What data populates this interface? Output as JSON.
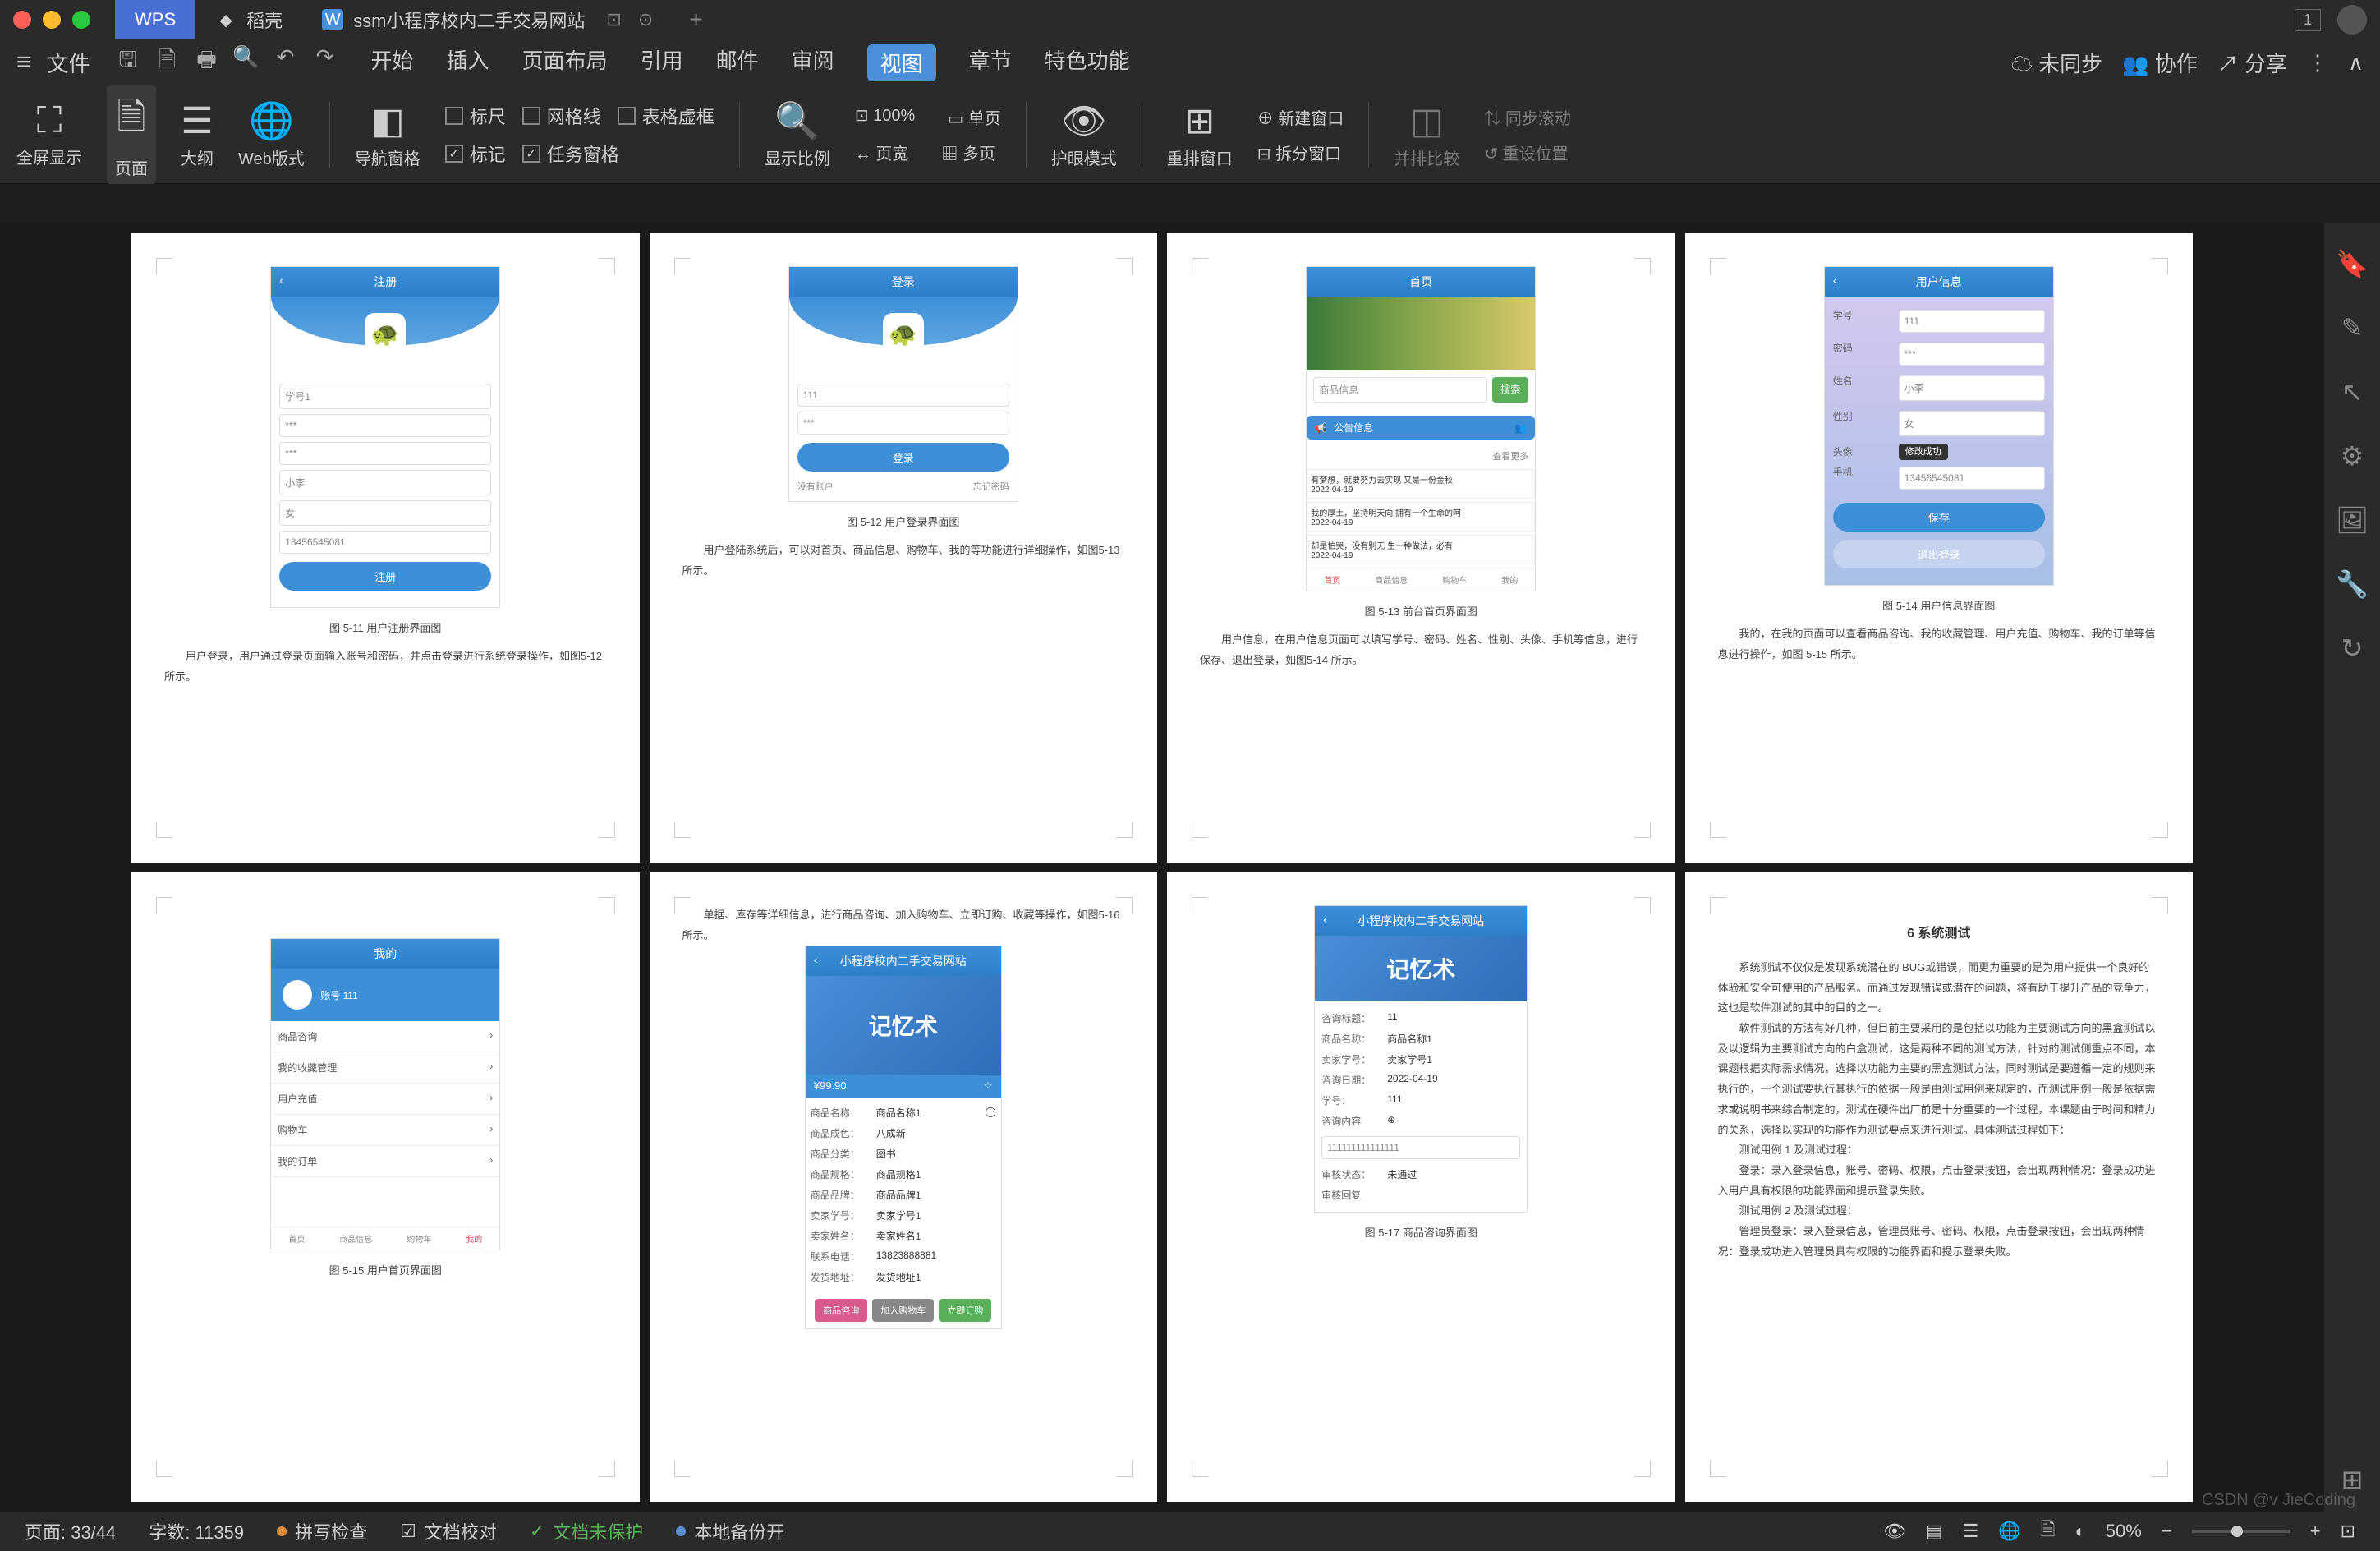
{
  "titlebar": {
    "tabs": [
      {
        "label": "WPS",
        "active": true
      },
      {
        "label": "稻壳",
        "active": false
      },
      {
        "label": "ssm小程序校内二手交易网站",
        "active": false
      }
    ]
  },
  "menubar": {
    "file": "文件",
    "tabs": [
      "开始",
      "插入",
      "页面布局",
      "引用",
      "邮件",
      "审阅",
      "视图",
      "章节",
      "特色功能"
    ],
    "active_tab": "视图",
    "right": {
      "sync": "未同步",
      "collab": "协作",
      "share": "分享"
    }
  },
  "ribbon": {
    "fullscreen": "全屏显示",
    "page": "页面",
    "outline": "大纲",
    "web": "Web版式",
    "nav_pane": "导航窗格",
    "ruler": "标尺",
    "gridlines": "网格线",
    "table_gridlines": "表格虚框",
    "markup": "标记",
    "task_pane": "任务窗格",
    "zoom": "显示比例",
    "zoom100": "100%",
    "page_width": "页宽",
    "single_page": "单页",
    "multi_page": "多页",
    "eye_mode": "护眼模式",
    "rearrange": "重排窗口",
    "new_window": "新建窗口",
    "split_window": "拆分窗口",
    "side_by_side": "并排比较",
    "sync_scroll": "同步滚动",
    "reset_pos": "重设位置"
  },
  "pages": {
    "p1": {
      "mobile_title": "注册",
      "fields": [
        "学号1",
        "***",
        "***",
        "小李",
        "女",
        "13456545081"
      ],
      "btn": "注册",
      "caption": "图 5-11 用户注册界面图",
      "text": "用户登录，用户通过登录页面输入账号和密码，并点击登录进行系统登录操作，如图5-12所示。"
    },
    "p2": {
      "mobile_title": "登录",
      "fields": [
        "111",
        "***"
      ],
      "btn": "登录",
      "link": "没有账户",
      "forgot": "忘记密码",
      "caption": "图 5-12 用户登录界面图",
      "text": "用户登陆系统后，可以对首页、商品信息、购物车、我的等功能进行详细操作，如图5-13 所示。"
    },
    "p3": {
      "mobile_title": "首页",
      "search_placeholder": "商品信息",
      "search_btn": "搜索",
      "notice": "公告信息",
      "more": "查看更多",
      "caption": "图 5-13 前台首页界面图",
      "text": "用户信息，在用户信息页面可以填写学号、密码、姓名、性别、头像、手机等信息，进行保存、退出登录，如图5-14 所示。"
    },
    "p4": {
      "mobile_title": "用户信息",
      "labels": [
        "学号",
        "密码",
        "姓名",
        "性别",
        "头像",
        "手机"
      ],
      "values": [
        "111",
        "***",
        "小李",
        "女",
        "修改成功",
        "13456545081"
      ],
      "btn_save": "保存",
      "btn_logout": "退出登录",
      "caption": "图 5-14 用户信息界面图",
      "text": "我的，在我的页面可以查看商品咨询、我的收藏管理、用户充值、购物车、我的订单等信息进行操作，如图 5-15 所示。"
    },
    "p5": {
      "mobile_title": "我的",
      "user": "账号 111",
      "items": [
        "商品咨询",
        "我的收藏管理",
        "用户充值",
        "购物车",
        "我的订单"
      ],
      "nav": [
        "首页",
        "商品信息",
        "购物车",
        "我的"
      ],
      "caption": "图 5-15 用户首页界面图"
    },
    "p6": {
      "text_top": "单据、库存等详细信息，进行商品咨询、加入购物车、立即订购、收藏等操作，如图5-16 所示。",
      "mobile_title": "小程序校内二手交易网站",
      "book_title": "记忆术",
      "price": "¥99.90",
      "rows": [
        [
          "商品名称：",
          "商品名称1"
        ],
        [
          "商品成色：",
          "八成新"
        ],
        [
          "商品分类：",
          "图书"
        ],
        [
          "商品规格：",
          "商品规格1"
        ],
        [
          "商品品牌：",
          "商品品牌1"
        ],
        [
          "卖家学号：",
          "卖家学号1"
        ],
        [
          "卖家姓名：",
          "卖家姓名1"
        ],
        [
          "联系电话：",
          "13823888881"
        ],
        [
          "发货地址：",
          "发货地址1"
        ]
      ],
      "actions": [
        "商品咨询",
        "加入购物车",
        "立即订购"
      ]
    },
    "p7": {
      "mobile_title": "小程序校内二手交易网站",
      "book_title": "记忆术",
      "rows": [
        [
          "咨询标题：",
          "11"
        ],
        [
          "商品名称：",
          "商品名称1"
        ],
        [
          "卖家学号：",
          "卖家学号1"
        ],
        [
          "咨询日期：",
          "2022-04-19"
        ],
        [
          "学号：",
          "111"
        ],
        [
          "咨询内容",
          ""
        ],
        [
          "",
          "111111111111111"
        ],
        [
          "审核状态：",
          "未通过"
        ],
        [
          "审核回复",
          ""
        ]
      ],
      "caption": "图 5-17 商品咨询界面图"
    },
    "p8": {
      "title": "6 系统测试",
      "para1": "系统测试不仅仅是发现系统潜在的 BUG或错误，而更为重要的是为用户提供一个良好的体验和安全可使用的产品服务。而通过发现错误或潜在的问题，将有助于提升产品的竞争力，这也是软件测试的其中的目的之一。",
      "para2": "软件测试的方法有好几种，但目前主要采用的是包括以功能为主要测试方向的黑盒测试以及以逻辑为主要测试方向的白盒测试，这是两种不同的测试方法，针对的测试侧重点不同，本课题根据实际需求情况，选择以功能为主要的黑盒测试方法，同时测试是要遵循一定的规则来执行的，一个测试要执行其执行的依据一般是由测试用例来规定的，而测试用例一般是依据需求或说明书来综合制定的，测试在硬件出厂前是十分重要的一个过程，本课题由于时间和精力的关系，选择以实现的功能作为测试要点来进行测试。具体测试过程如下：",
      "case1_title": "测试用例 1 及测试过程：",
      "case1_text": "登录：录入登录信息，账号、密码、权限，点击登录按钮，会出现两种情况：登录成功进入用户具有权限的功能界面和提示登录失败。",
      "case2_title": "测试用例 2 及测试过程：",
      "case2_text": "管理员登录：录入登录信息，管理员账号、密码、权限，点击登录按钮，会出现两种情况：登录成功进入管理员具有权限的功能界面和提示登录失败。"
    }
  },
  "statusbar": {
    "page": "页面: 33/44",
    "words": "字数: 11359",
    "spellcheck": "拼写检查",
    "proofread": "文档校对",
    "unprotected": "文档未保护",
    "backup": "本地备份开",
    "zoom": "50%"
  },
  "watermark": "CSDN @v JieCoding"
}
